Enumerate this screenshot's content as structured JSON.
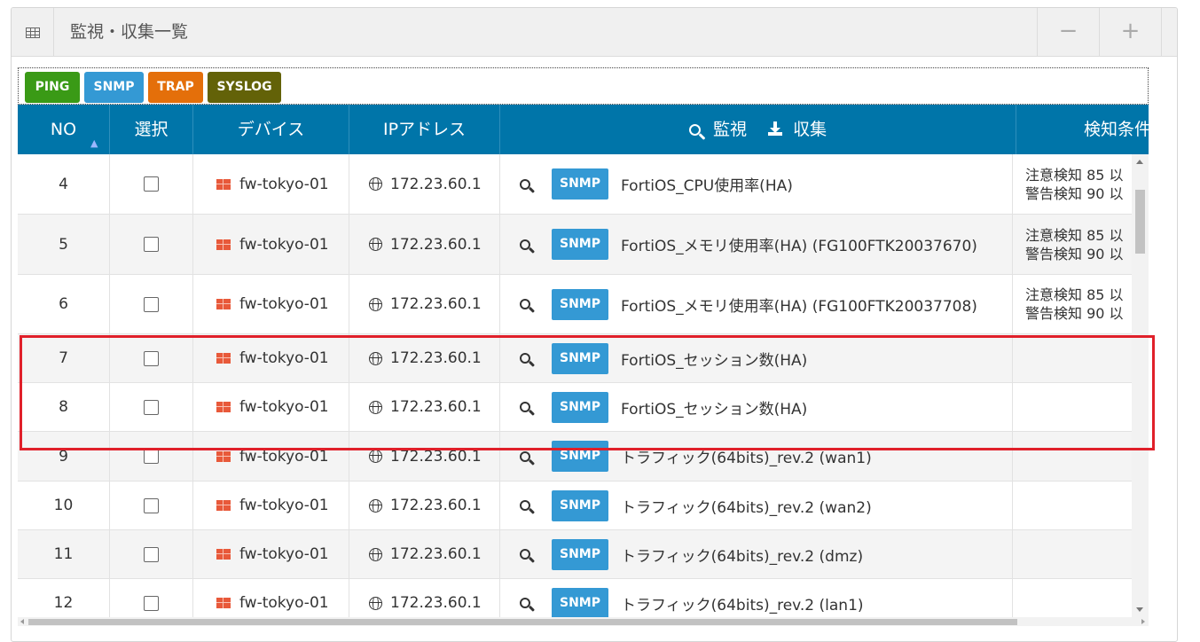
{
  "panel": {
    "title": "監視・収集一覧",
    "minus_label": "−",
    "plus_label": "+"
  },
  "tags": [
    {
      "label": "PING",
      "color": "#3a9a16"
    },
    {
      "label": "SNMP",
      "color": "#3499d4"
    },
    {
      "label": "TRAP",
      "color": "#e46f0a"
    },
    {
      "label": "SYSLOG",
      "color": "#636208"
    }
  ],
  "table": {
    "headers": {
      "no": "NO",
      "select": "選択",
      "device": "デバイス",
      "ip": "IPアドレス",
      "monitor": "監視",
      "collect": "収集",
      "condition": "検知条件"
    },
    "rows": [
      {
        "no": "4",
        "device": "fw-tokyo-01",
        "ip": "172.23.60.1",
        "type": "SNMP",
        "item": "FortiOS_CPU使用率(HA)",
        "cond1": "注意検知 85 以",
        "cond2": "警告検知 90 以"
      },
      {
        "no": "5",
        "device": "fw-tokyo-01",
        "ip": "172.23.60.1",
        "type": "SNMP",
        "item": "FortiOS_メモリ使用率(HA) (FG100FTK20037670)",
        "cond1": "注意検知 85 以",
        "cond2": "警告検知 90 以"
      },
      {
        "no": "6",
        "device": "fw-tokyo-01",
        "ip": "172.23.60.1",
        "type": "SNMP",
        "item": "FortiOS_メモリ使用率(HA) (FG100FTK20037708)",
        "cond1": "注意検知 85 以",
        "cond2": "警告検知 90 以"
      },
      {
        "no": "7",
        "device": "fw-tokyo-01",
        "ip": "172.23.60.1",
        "type": "SNMP",
        "item": "FortiOS_セッション数(HA)",
        "cond1": "",
        "cond2": ""
      },
      {
        "no": "8",
        "device": "fw-tokyo-01",
        "ip": "172.23.60.1",
        "type": "SNMP",
        "item": "FortiOS_セッション数(HA)",
        "cond1": "",
        "cond2": ""
      },
      {
        "no": "9",
        "device": "fw-tokyo-01",
        "ip": "172.23.60.1",
        "type": "SNMP",
        "item": "トラフィック(64bits)_rev.2 (wan1)",
        "cond1": "",
        "cond2": ""
      },
      {
        "no": "10",
        "device": "fw-tokyo-01",
        "ip": "172.23.60.1",
        "type": "SNMP",
        "item": "トラフィック(64bits)_rev.2 (wan2)",
        "cond1": "",
        "cond2": ""
      },
      {
        "no": "11",
        "device": "fw-tokyo-01",
        "ip": "172.23.60.1",
        "type": "SNMP",
        "item": "トラフィック(64bits)_rev.2 (dmz)",
        "cond1": "",
        "cond2": ""
      },
      {
        "no": "12",
        "device": "fw-tokyo-01",
        "ip": "172.23.60.1",
        "type": "SNMP",
        "item": "トラフィック(64bits)_rev.2 (lan1)",
        "cond1": "",
        "cond2": ""
      }
    ]
  },
  "colors": {
    "header_bg": "#0075a9",
    "snmp_button": "#3499d4",
    "highlight_border": "#e0202a"
  },
  "icons": {
    "panel": "table-grid-icon",
    "device": "firewall-icon",
    "ip": "globe-icon",
    "monitor": "search-icon",
    "collect": "download-icon"
  }
}
